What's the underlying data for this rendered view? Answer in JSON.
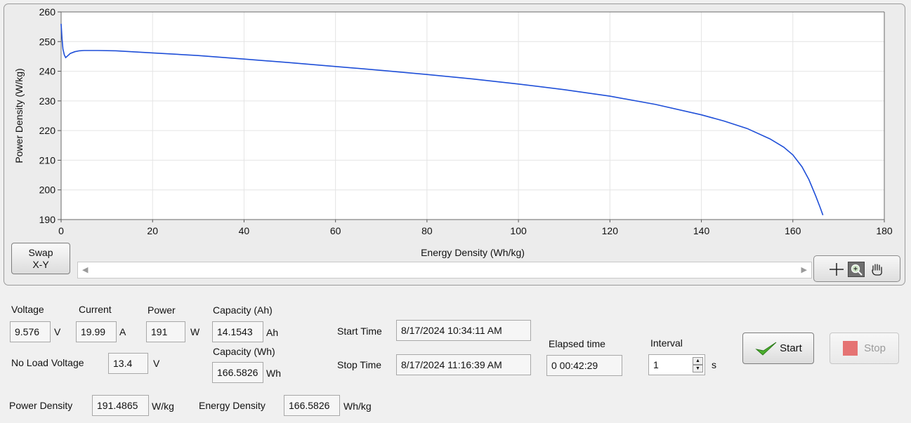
{
  "chart_data": {
    "type": "line",
    "xlabel": "Energy Density (Wh/kg)",
    "ylabel": "Power Density (W/kg)",
    "xlim": [
      0,
      180
    ],
    "ylim": [
      190,
      260
    ],
    "x_ticks": [
      "0",
      "20",
      "40",
      "60",
      "80",
      "100",
      "120",
      "140",
      "160",
      "180"
    ],
    "y_ticks": [
      "260",
      "250",
      "240",
      "230",
      "220",
      "210",
      "200",
      "190"
    ],
    "grid": true,
    "colors": {
      "line": "#1f4fd8",
      "plot_bg": "#ffffff",
      "grid": "#e4e4e4"
    },
    "series": [
      {
        "x": [
          0,
          0.2,
          0.4,
          0.7,
          1.0,
          1.5,
          2,
          3,
          4,
          5,
          8,
          12,
          20,
          30,
          40,
          50,
          60,
          70,
          80,
          90,
          100,
          110,
          120,
          130,
          140,
          145,
          150,
          155,
          158,
          160,
          162,
          163.5,
          165,
          166,
          166.58
        ],
        "y": [
          256,
          251,
          247.5,
          245.5,
          244.6,
          245.3,
          246,
          246.6,
          246.9,
          247,
          247,
          246.9,
          246.2,
          245.3,
          244.1,
          242.9,
          241.6,
          240.3,
          238.9,
          237.4,
          235.7,
          233.8,
          231.6,
          228.8,
          225.3,
          223.2,
          220.7,
          217.2,
          214.4,
          211.8,
          207.8,
          203.5,
          198,
          194,
          191.5
        ]
      }
    ]
  },
  "graph": {
    "swap_line1": "Swap",
    "swap_line2": "X-Y",
    "tools": [
      "crosshair-cursor-icon",
      "zoom-icon",
      "pan-hand-icon"
    ]
  },
  "readings": {
    "voltage_label": "Voltage",
    "voltage_value": "9.576",
    "voltage_unit": "V",
    "current_label": "Current",
    "current_value": "19.99",
    "current_unit": "A",
    "power_label": "Power",
    "power_value": "191",
    "power_unit": "W",
    "capacity_ah_label": "Capacity (Ah)",
    "capacity_ah_value": "14.1543",
    "capacity_ah_unit": "Ah",
    "capacity_wh_label": "Capacity (Wh)",
    "capacity_wh_value": "166.5826",
    "capacity_wh_unit": "Wh",
    "no_load_label": "No Load Voltage",
    "no_load_value": "13.4",
    "no_load_unit": "V",
    "power_density_label": "Power Density",
    "power_density_value": "191.4865",
    "power_density_unit": "W/kg",
    "energy_density_label": "Energy Density",
    "energy_density_value": "166.5826",
    "energy_density_unit": "Wh/kg"
  },
  "timing": {
    "start_label": "Start Time",
    "start_value": "8/17/2024 10:34:11 AM",
    "stop_label": "Stop Time",
    "stop_value": "8/17/2024 11:16:39 AM",
    "elapsed_label": "Elapsed time",
    "elapsed_value": "0  00:42:29",
    "interval_label": "Interval",
    "interval_value": "1",
    "interval_unit": "s"
  },
  "controls": {
    "start_label": "Start",
    "stop_label": "Stop",
    "start_icon_color": "#4caf2e",
    "stop_icon_color": "#e57373"
  }
}
